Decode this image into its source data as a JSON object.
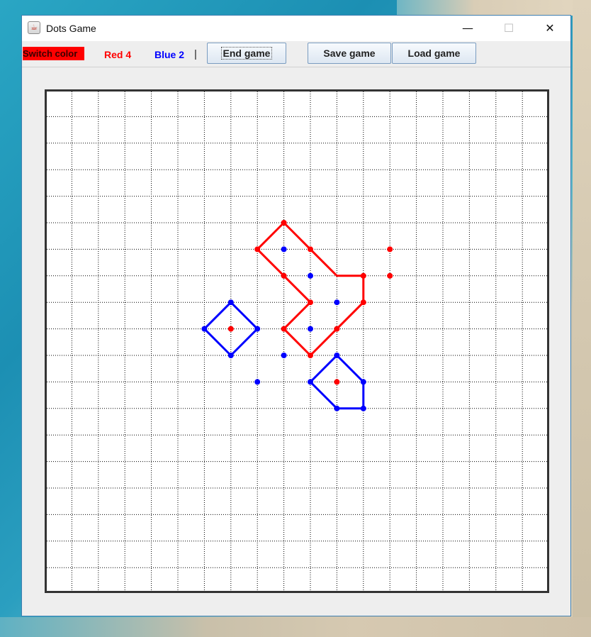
{
  "window": {
    "title": "Dots Game",
    "minimize_glyph": "—",
    "maximize_glyph": "☐",
    "close_glyph": "✕",
    "app_icon": "java-cup-icon"
  },
  "toolbar": {
    "switch_color_label": "Switch color",
    "red_score": "Red 4",
    "blue_score": "Blue 2",
    "separator": "|",
    "end_game_label": "End game",
    "save_game_label": "Save game",
    "load_game_label": "Load game"
  },
  "colors": {
    "red": "#ff0000",
    "blue": "#0000ff",
    "grid": "#000000",
    "board_border": "#333333"
  },
  "board": {
    "columns": 19,
    "rows": 19,
    "red_dots": [
      [
        9,
        5
      ],
      [
        8,
        6
      ],
      [
        10,
        6
      ],
      [
        13,
        6
      ],
      [
        9,
        7
      ],
      [
        12,
        7
      ],
      [
        13,
        7
      ],
      [
        10,
        8
      ],
      [
        12,
        8
      ],
      [
        7,
        9
      ],
      [
        9,
        9
      ],
      [
        11,
        9
      ],
      [
        10,
        10
      ],
      [
        11,
        11
      ]
    ],
    "blue_dots": [
      [
        9,
        6
      ],
      [
        10,
        7
      ],
      [
        11,
        8
      ],
      [
        7,
        8
      ],
      [
        6,
        9
      ],
      [
        8,
        9
      ],
      [
        10,
        9
      ],
      [
        7,
        10
      ],
      [
        9,
        10
      ],
      [
        11,
        10
      ],
      [
        8,
        11
      ],
      [
        10,
        11
      ],
      [
        12,
        11
      ],
      [
        11,
        12
      ],
      [
        12,
        12
      ]
    ],
    "red_polygons": [
      [
        [
          9,
          5
        ],
        [
          8,
          6
        ],
        [
          9,
          7
        ],
        [
          10,
          8
        ],
        [
          9,
          9
        ],
        [
          10,
          10
        ],
        [
          11,
          9
        ],
        [
          12,
          8
        ],
        [
          12,
          7
        ],
        [
          11,
          7
        ],
        [
          10,
          6
        ]
      ]
    ],
    "blue_polygons": [
      [
        [
          7,
          8
        ],
        [
          6,
          9
        ],
        [
          7,
          10
        ],
        [
          8,
          9
        ]
      ],
      [
        [
          11,
          10
        ],
        [
          10,
          11
        ],
        [
          11,
          12
        ],
        [
          12,
          12
        ],
        [
          12,
          11
        ]
      ]
    ]
  }
}
